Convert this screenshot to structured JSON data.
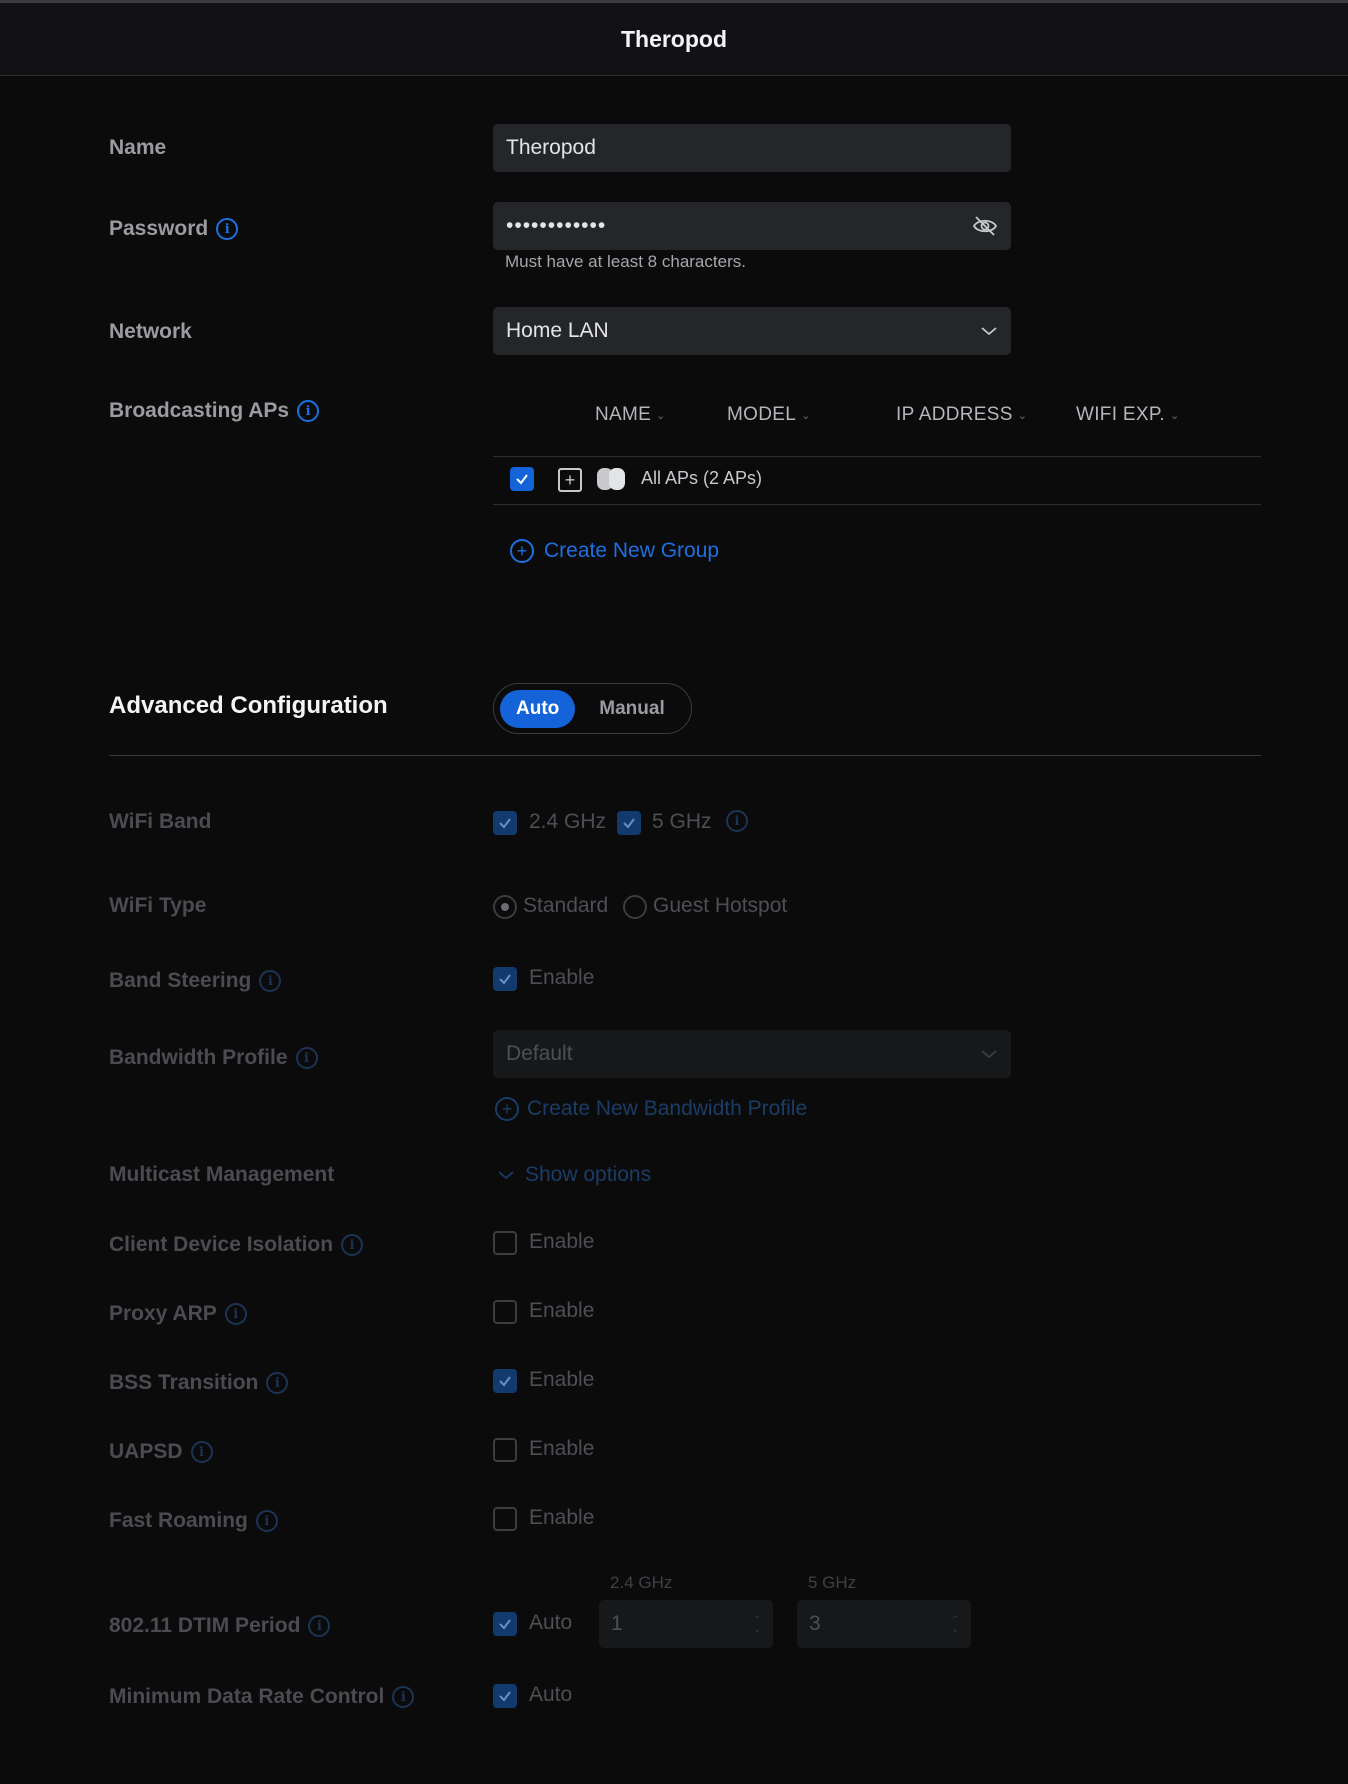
{
  "window": {
    "title": "Theropod"
  },
  "name": {
    "label": "Name",
    "value": "Theropod"
  },
  "password": {
    "label": "Password",
    "value": "••••••••••••",
    "hint": "Must have at least 8 characters."
  },
  "network": {
    "label": "Network",
    "value": "Home LAN"
  },
  "broadcasting": {
    "label": "Broadcasting APs",
    "columns": [
      "NAME",
      "MODEL",
      "IP ADDRESS",
      "WIFI EXP."
    ],
    "group_label": "All APs (2 APs)",
    "create_group": "Create New Group"
  },
  "advanced": {
    "title": "Advanced Configuration",
    "mode_auto": "Auto",
    "mode_manual": "Manual",
    "active_mode": "Auto"
  },
  "wifi_band": {
    "label": "WiFi Band",
    "opt1": "2.4 GHz",
    "opt2": "5 GHz"
  },
  "wifi_type": {
    "label": "WiFi Type",
    "opt1": "Standard",
    "opt2": "Guest Hotspot",
    "selected": "Standard"
  },
  "band_steering": {
    "label": "Band Steering",
    "opt": "Enable",
    "checked": true
  },
  "bandwidth_profile": {
    "label": "Bandwidth Profile",
    "value": "Default",
    "create": "Create New Bandwidth Profile"
  },
  "multicast": {
    "label": "Multicast Management",
    "toggle": "Show options"
  },
  "client_isolation": {
    "label": "Client Device Isolation",
    "opt": "Enable",
    "checked": false
  },
  "proxy_arp": {
    "label": "Proxy ARP",
    "opt": "Enable",
    "checked": false
  },
  "bss_transition": {
    "label": "BSS Transition",
    "opt": "Enable",
    "checked": true
  },
  "uapsd": {
    "label": "UAPSD",
    "opt": "Enable",
    "checked": false
  },
  "fast_roaming": {
    "label": "Fast Roaming",
    "opt": "Enable",
    "checked": false
  },
  "dtim": {
    "label": "802.11 DTIM Period",
    "auto": "Auto",
    "band1": "2.4 GHz",
    "band1_value": "1",
    "band2": "5 GHz",
    "band2_value": "3"
  },
  "min_rate": {
    "label": "Minimum Data Rate Control",
    "auto": "Auto"
  },
  "colors": {
    "accent": "#1463d8",
    "background": "#0b0b0c",
    "field": "#252629"
  }
}
